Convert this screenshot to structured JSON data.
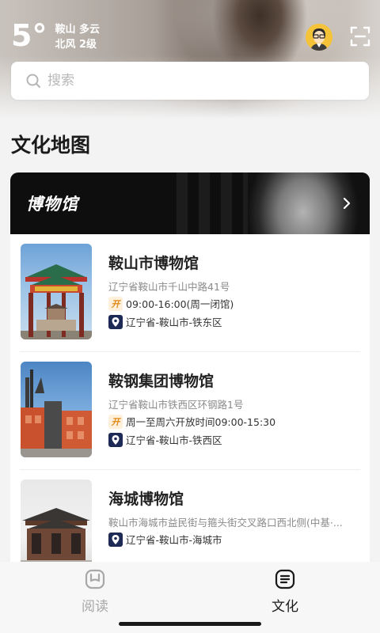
{
  "weather": {
    "temperature": "5°",
    "location_condition": "鞍山 多云",
    "wind": "北风 2级"
  },
  "search": {
    "placeholder": "搜索"
  },
  "section": {
    "title": "文化地图"
  },
  "banner": {
    "title": "博物馆"
  },
  "museums": [
    {
      "name": "鞍山市博物馆",
      "address": "辽宁省鞍山市千山中路41号",
      "open_icon": "开",
      "hours": "09:00-16:00(周一闭馆)",
      "region": "辽宁省-鞍山市-铁东区"
    },
    {
      "name": "鞍钢集团博物馆",
      "address": "辽宁省鞍山市铁西区环钢路1号",
      "open_icon": "开",
      "hours": "周一至周六开放时间09:00-15:30",
      "region": "辽宁省-鞍山市-铁西区"
    },
    {
      "name": "海城博物馆",
      "address": "鞍山市海城市益民街与箍头街交叉路口西北侧(中基·...",
      "region": "辽宁省-鞍山市-海城市"
    }
  ],
  "nav": {
    "read_label": "阅读",
    "culture_label": "文化"
  },
  "colors": {
    "accent": "#f5c33a",
    "open_badge": "#e08a17",
    "pin_badge": "#1c2a55",
    "banner_bg": "#0e0e0e"
  },
  "icons": {
    "search": "search-icon",
    "scan": "scan-icon",
    "avatar": "avatar-icon",
    "arrow": "chevron-right-icon",
    "pin": "location-pin-icon",
    "read": "book-icon",
    "culture": "list-icon"
  }
}
